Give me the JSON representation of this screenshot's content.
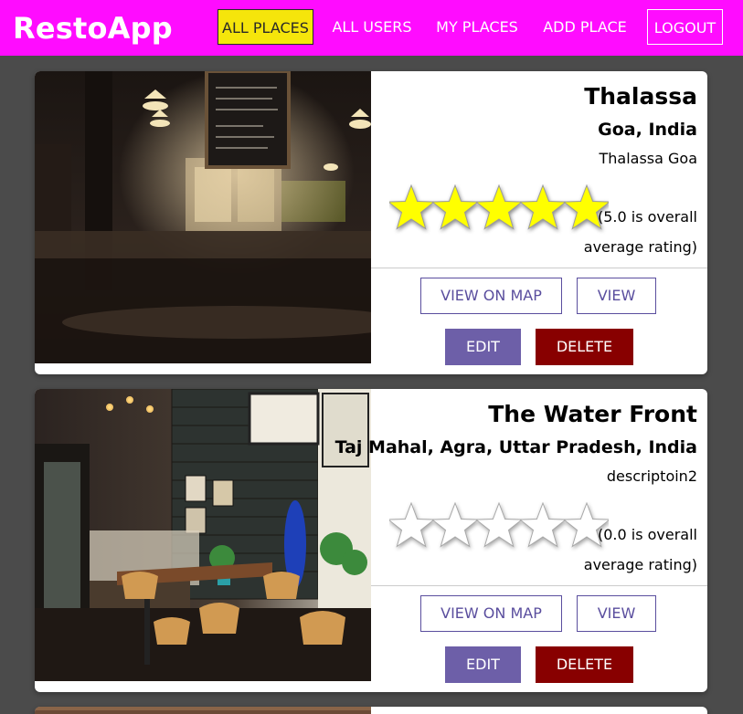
{
  "app": {
    "title": "RestoApp"
  },
  "nav": {
    "all_places": "ALL PLACES",
    "all_users": "ALL USERS",
    "my_places": "MY PLACES",
    "add_place": "ADD PLACE",
    "logout": "LOGOUT"
  },
  "places": [
    {
      "title": "Thalassa",
      "address": "Goa, India",
      "description": "Thalassa Goa",
      "rating": 5.0,
      "rating_line1": "(5.0 is overall",
      "rating_line2": "average rating)",
      "view_on_map": "VIEW ON MAP",
      "view": "VIEW",
      "edit": "EDIT",
      "delete": "DELETE"
    },
    {
      "title": "The Water Front",
      "address": "Taj Mahal, Agra, Uttar Pradesh, India",
      "description": "descriptoin2",
      "rating": 0.0,
      "rating_line1": "(0.0 is overall",
      "rating_line2": "average rating)",
      "view_on_map": "VIEW ON MAP",
      "view": "VIEW",
      "edit": "EDIT",
      "delete": "DELETE"
    }
  ],
  "colors": {
    "header": "#ff0cff",
    "active_nav": "#f5e50b",
    "star_filled": "#ffff00",
    "edit": "#6d5fa8",
    "delete": "#880000",
    "background": "#4b4b4b"
  }
}
